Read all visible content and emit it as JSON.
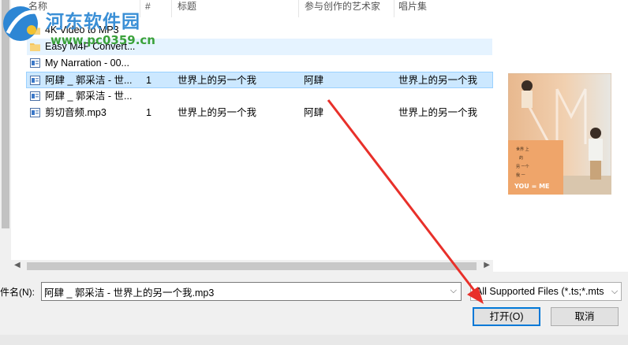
{
  "columns": {
    "name": "名称",
    "num": "#",
    "title": "标题",
    "artist": "参与创作的艺术家",
    "album": "唱片集"
  },
  "files": [
    {
      "name": "4K Video to MP3",
      "type": "folder",
      "num": "",
      "title": "",
      "artist": "",
      "album": ""
    },
    {
      "name": "Easy M4P Convert...",
      "type": "folder",
      "num": "",
      "title": "",
      "artist": "",
      "album": ""
    },
    {
      "name": "My Narration - 00...",
      "type": "audio",
      "num": "",
      "title": "",
      "artist": "",
      "album": ""
    },
    {
      "name": "阿肆 _ 郭采洁 - 世...",
      "type": "audio",
      "num": "1",
      "title": "世界上的另一个我",
      "artist": "阿肆",
      "album": "世界上的另一个我",
      "selected": true
    },
    {
      "name": "阿肆 _ 郭采洁 - 世...",
      "type": "audio",
      "num": "",
      "title": "",
      "artist": "",
      "album": ""
    },
    {
      "name": "剪切音频.mp3",
      "type": "audio",
      "num": "1",
      "title": "世界上的另一个我",
      "artist": "阿肆",
      "album": "世界上的另一个我"
    }
  ],
  "preview": {
    "cover_lines": [
      "世界 上",
      "的",
      "另 一个",
      "我 一"
    ],
    "cover_title": "YOU = ME"
  },
  "bottom": {
    "filename_label": "件名(N):",
    "filename_value": "阿肆 _ 郭采洁 - 世界上的另一个我.mp3",
    "filetype_value": "All Supported Files (*.ts;*.mts",
    "open_label": "打开(O)",
    "cancel_label": "取消"
  },
  "watermark": {
    "text": "河东软件园",
    "url": "www.pc0359.cn"
  },
  "colors": {
    "selection": "#cce8ff",
    "accent": "#0078d7",
    "arrow": "#e8302a",
    "folder": "#f5c45e"
  }
}
